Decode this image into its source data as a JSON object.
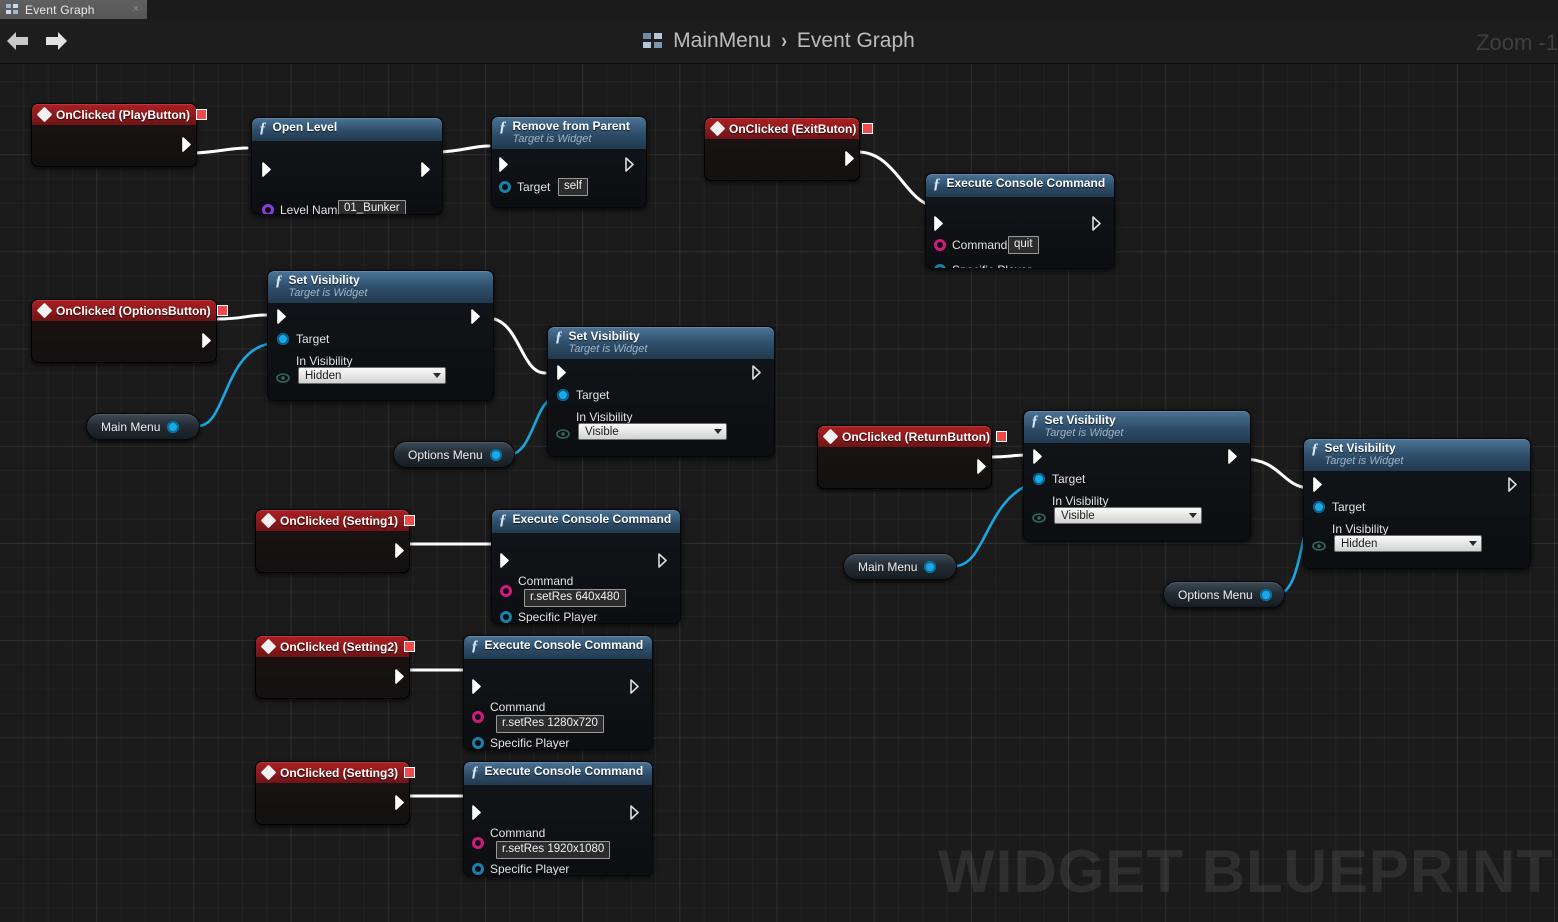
{
  "tab": {
    "label": "Event Graph",
    "close": "×"
  },
  "toolbar": {
    "breadcrumb_root": "MainMenu",
    "breadcrumb_sep": "›",
    "breadcrumb_current": "Event Graph",
    "zoom_label": "Zoom -1"
  },
  "canvas": {
    "watermark": "WIDGET BLUEPRINT"
  },
  "labels": {
    "target": "Target",
    "in_visibility": "In Visibility",
    "command": "Command",
    "specific_player": "Specific Player",
    "level_name": "Level Name",
    "target_is_widget": "Target is Widget"
  },
  "nodes": [
    {
      "id": "n1",
      "kind": "event",
      "title": "OnClicked (PlayButton)"
    },
    {
      "id": "n2",
      "kind": "fn",
      "title": "Open Level",
      "subtitle": "",
      "value": "01_Bunker"
    },
    {
      "id": "n3",
      "kind": "fn",
      "title": "Remove from Parent",
      "subtitle": "Target is Widget",
      "value": "self"
    },
    {
      "id": "n4",
      "kind": "event",
      "title": "OnClicked (ExitButon)"
    },
    {
      "id": "n5",
      "kind": "fn",
      "title": "Execute Console Command",
      "subtitle": "",
      "value": "quit"
    },
    {
      "id": "n6",
      "kind": "event",
      "title": "OnClicked (OptionsButton)"
    },
    {
      "id": "n7",
      "kind": "fn",
      "title": "Set Visibility",
      "subtitle": "Target is Widget",
      "value": "Hidden"
    },
    {
      "id": "n8",
      "kind": "fn",
      "title": "Set Visibility",
      "subtitle": "Target is Widget",
      "value": "Visible"
    },
    {
      "id": "n9",
      "kind": "event",
      "title": "OnClicked (ReturnButton)"
    },
    {
      "id": "n10",
      "kind": "fn",
      "title": "Set Visibility",
      "subtitle": "Target is Widget",
      "value": "Visible"
    },
    {
      "id": "n11",
      "kind": "fn",
      "title": "Set Visibility",
      "subtitle": "Target is Widget",
      "value": "Hidden"
    },
    {
      "id": "n12",
      "kind": "event",
      "title": "OnClicked (Setting1)"
    },
    {
      "id": "n13",
      "kind": "fn",
      "title": "Execute Console Command",
      "subtitle": "",
      "value": "r.setRes 640x480"
    },
    {
      "id": "n14",
      "kind": "event",
      "title": "OnClicked (Setting2)"
    },
    {
      "id": "n15",
      "kind": "fn",
      "title": "Execute Console Command",
      "subtitle": "",
      "value": "r.setRes 1280x720"
    },
    {
      "id": "n16",
      "kind": "event",
      "title": "OnClicked (Setting3)"
    },
    {
      "id": "n17",
      "kind": "fn",
      "title": "Execute Console Command",
      "subtitle": "",
      "value": "r.setRes 1920x1080"
    }
  ],
  "variables": [
    {
      "id": "v1",
      "label": "Main Menu"
    },
    {
      "id": "v2",
      "label": "Options Menu"
    },
    {
      "id": "v3",
      "label": "Main Menu"
    },
    {
      "id": "v4",
      "label": "Options Menu"
    }
  ],
  "colors": {
    "event_header": "#ac1f22",
    "function_header": "#4a7496",
    "exec_pin": "#ffffff",
    "object_pin": "#19a9e8",
    "string_pin": "#cf1b7b",
    "name_pin": "#8b3fd6",
    "wire_exec": "#ffffff",
    "wire_data": "#1aa6e0"
  }
}
